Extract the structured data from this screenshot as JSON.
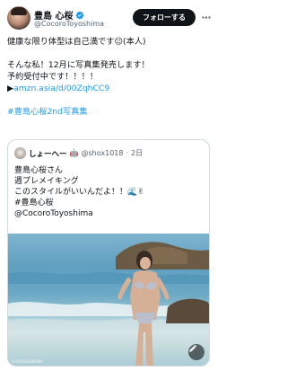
{
  "colors": {
    "accent": "#1d9bf0",
    "text": "#0f1419",
    "muted": "#536471",
    "border": "#cfd9de",
    "button": "#0f1419"
  },
  "header": {
    "display_name": "豊島 心桜",
    "handle": "@CocoroToyoshima",
    "follow_label": "フォローする",
    "verified_icon": "verified-badge-icon",
    "more_icon": "more-icon"
  },
  "tweet": {
    "line1": "健康な限り体型は自己満です☺(本人)",
    "line2": "そんな私！12月に写真集発売します！",
    "line3": "予約受付中です！！！！",
    "link_prefix": "▶",
    "link": "amzn.asia/d/00ZqhCC9",
    "hashtag": "#豊島心桜2nd写真集"
  },
  "quote": {
    "name": "しょーへー",
    "badge_emoji": "🤖",
    "handle": "@shox1018",
    "separator": "·",
    "date": "2日",
    "lines": [
      "豊島心桜さん",
      "週プレメイキング",
      "このスタイルがいいんだよ！！🌊✌",
      "#豊島心桜",
      "@CocoroToyoshima"
    ],
    "watermark": "©2024SHUEISHA",
    "alt_icon": "image-edit-icon"
  }
}
